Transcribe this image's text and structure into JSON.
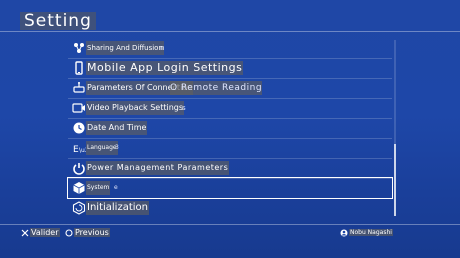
{
  "header": {
    "title": "Setting"
  },
  "menu": {
    "items": [
      {
        "label": "Sharing And Diffusion",
        "suffix": "n"
      },
      {
        "label": "Mobile App Login Settings",
        "suffix": ""
      },
      {
        "label": "Parameters Of Connection",
        "suffix": "O Remote Reading"
      },
      {
        "label": "Video Playback Settings",
        "suffix": "s"
      },
      {
        "label": "Date And Time",
        "suffix": ""
      },
      {
        "label": "Language",
        "suffix": "3"
      },
      {
        "label": "Power Management Parameters",
        "suffix": ""
      },
      {
        "label": "System",
        "suffix": "e"
      },
      {
        "label": "Initialization",
        "suffix": ""
      }
    ],
    "selected_index": 7
  },
  "footer": {
    "confirm_label": "Valider",
    "back_label": "Previous",
    "user_label": "Nobu Nagashi"
  },
  "colors": {
    "background": "#1e47a8",
    "label_highlight": "#5f5f5f",
    "selection": "#ffffff"
  }
}
